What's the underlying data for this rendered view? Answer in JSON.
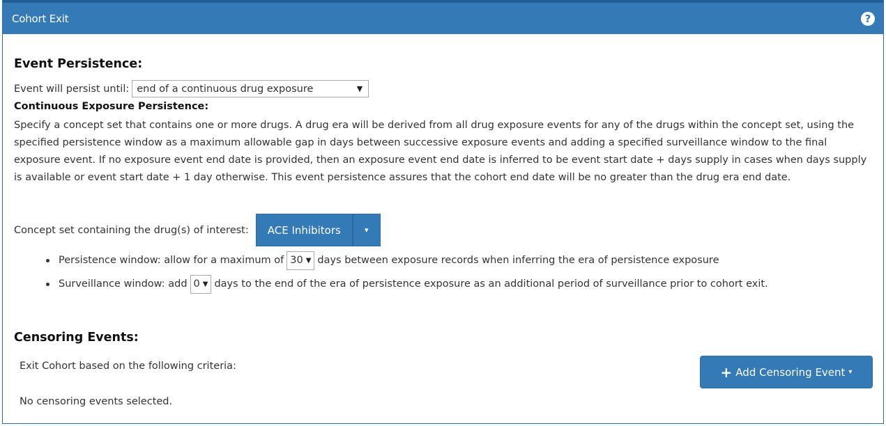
{
  "panel": {
    "title": "Cohort Exit",
    "help_icon": "?"
  },
  "event_persistence": {
    "heading": "Event Persistence:",
    "label": "Event will persist until:",
    "selected": "end of a continuous drug exposure",
    "caret": "▼"
  },
  "continuous_exposure": {
    "heading": "Continuous Exposure Persistence:",
    "description": "Specify a concept set that contains one or more drugs. A drug era will be derived from all drug exposure events for any of the drugs within the concept set, using the specified persistence window as a maximum allowable gap in days between successive exposure events and adding a specified surveillance window to the final exposure event. If no exposure event end date is provided, then an exposure event end date is inferred to be event start date + days supply in cases when days supply is available or event start date + 1 day otherwise. This event persistence assures that the cohort end date will be no greater than the drug era end date.",
    "concept_label": "Concept set containing the drug(s) of interest:",
    "concept_button": "ACE Inhibitors",
    "dropdown_caret": "▾"
  },
  "windows": {
    "persistence": {
      "prefix": "Persistence window: allow for a maximum of",
      "value": "30",
      "suffix": "days between exposure records when inferring the era of persistence exposure"
    },
    "surveillance": {
      "prefix": "Surveillance window: add",
      "value": "0",
      "suffix": "days to the end of the era of persistence exposure as an additional period of surveillance prior to cohort exit."
    },
    "caret": "▼"
  },
  "censoring": {
    "heading": "Censoring Events:",
    "exit_label": "Exit Cohort based on the following criteria:",
    "add_plus": "+",
    "add_button": "Add Censoring Event",
    "add_caret": "▾",
    "empty_text": "No censoring events selected."
  },
  "colors": {
    "primary": "#337ab7",
    "primary_border": "#2e6da4"
  }
}
